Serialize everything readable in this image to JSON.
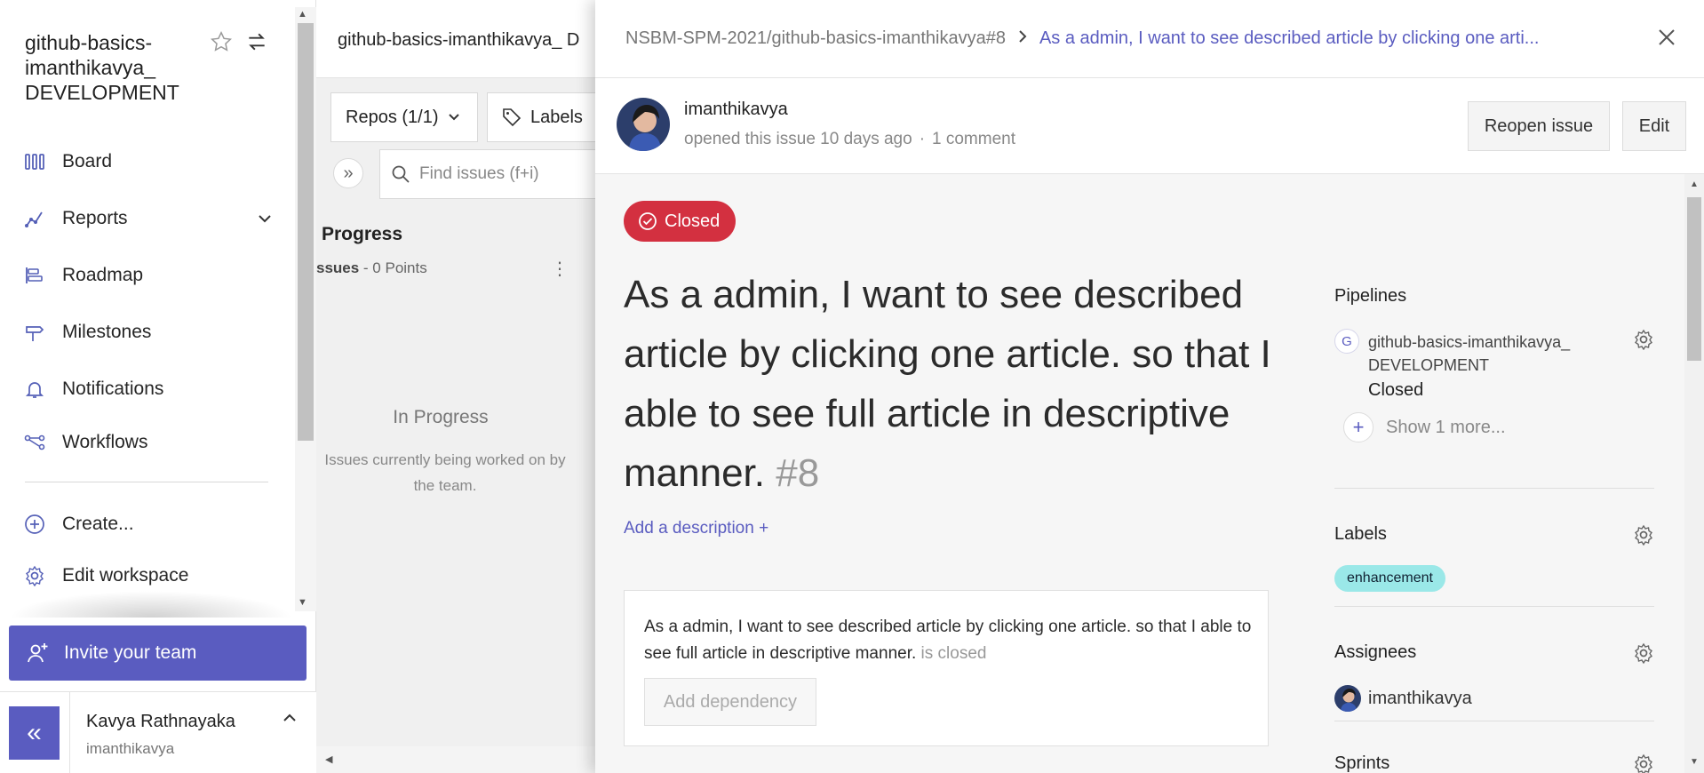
{
  "sidebar": {
    "workspace_title_line1": "github-basics-",
    "workspace_title_line2": "imanthikavya_",
    "workspace_title_line3": "DEVELOPMENT",
    "nav": [
      {
        "label": "Board",
        "icon": "board-icon"
      },
      {
        "label": "Reports",
        "icon": "reports-icon"
      },
      {
        "label": "Roadmap",
        "icon": "roadmap-icon"
      },
      {
        "label": "Milestones",
        "icon": "milestones-icon"
      },
      {
        "label": "Notifications",
        "icon": "bell-icon"
      },
      {
        "label": "Workflows",
        "icon": "workflows-icon"
      }
    ],
    "actions": [
      {
        "label": "Create...",
        "icon": "plus-circle-icon"
      },
      {
        "label": "Edit workspace",
        "icon": "gear-icon"
      }
    ],
    "invite_label": "Invite your team",
    "collapse_label": "«",
    "user": {
      "name": "Kavya Rathnayaka",
      "handle": "imanthikavya"
    }
  },
  "board": {
    "title": "github-basics-imanthikavya_ D",
    "filters": {
      "repos": "Repos (1/1)",
      "labels": "Labels"
    },
    "expand_label": "»",
    "search_placeholder": "Find issues (f+i)",
    "column": {
      "title": "Progress",
      "sub_prefix": "ssues",
      "sub_points": " - 0 Points",
      "empty_title": "In Progress",
      "empty_desc": "Issues currently being worked on by the team."
    }
  },
  "issue": {
    "breadcrumb_repo": "NSBM-SPM-2021/github-basics-imanthikavya#8",
    "breadcrumb_title": "As a admin, I want to see described article by clicking one arti...",
    "author": "imanthikavya",
    "opened_text": "opened this issue 10 days ago",
    "comments": "1 comment",
    "reopen_label": "Reopen issue",
    "edit_label": "Edit",
    "status": "Closed",
    "title": "As a admin, I want to see described article by clicking one article. so that I able to see full article in descriptive manner.",
    "number": "#8",
    "add_description": "Add a description +",
    "dependency_text": "As a admin, I want to see described article by clicking one article. so that I able to see full article in descriptive manner.",
    "dependency_state": "is closed",
    "add_dependency": "Add dependency"
  },
  "sidepanel": {
    "pipelines_heading": "Pipelines",
    "pipeline_badge": "G",
    "pipeline_name": "github-basics-imanthikavya_ DEVELOPMENT",
    "pipeline_status": "Closed",
    "show_more": "Show 1 more...",
    "labels_heading": "Labels",
    "label_chip": "enhancement",
    "assignees_heading": "Assignees",
    "assignee": "imanthikavya",
    "sprints_heading": "Sprints"
  },
  "colors": {
    "accent": "#5a5cc0",
    "closed_badge": "#d33040",
    "label_chip": "#9ae8e8"
  }
}
